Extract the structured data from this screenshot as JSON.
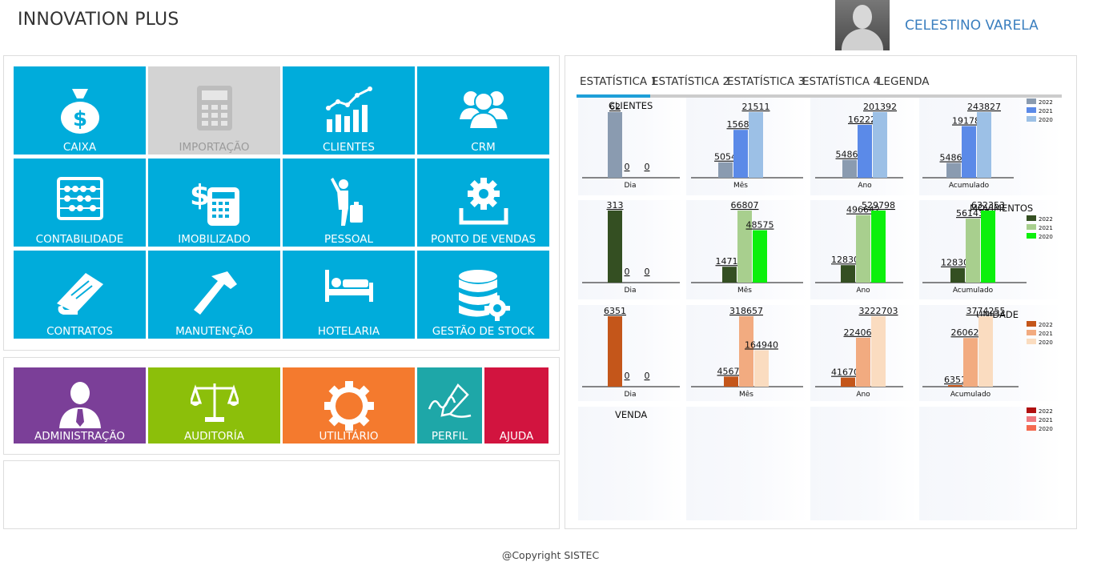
{
  "header": {
    "app_title": "INNOVATION PLUS",
    "user_name": "CELESTINO VARELA"
  },
  "modules": [
    {
      "label": "CAIXA",
      "icon": "money-bag-icon",
      "enabled": true
    },
    {
      "label": "IMPORTAÇÃO",
      "icon": "calculator-icon",
      "enabled": false
    },
    {
      "label": "CLIENTES",
      "icon": "chart-growth-icon",
      "enabled": true
    },
    {
      "label": "CRM",
      "icon": "users-icon",
      "enabled": true
    },
    {
      "label": "CONTABILIDADE",
      "icon": "abacus-icon",
      "enabled": true
    },
    {
      "label": "IMOBILIZADO",
      "icon": "dollar-calculator-icon",
      "enabled": true
    },
    {
      "label": "PESSOAL",
      "icon": "traveler-icon",
      "enabled": true
    },
    {
      "label": "PONTO DE VENDAS",
      "icon": "gear-tray-icon",
      "enabled": true
    },
    {
      "label": "CONTRATOS",
      "icon": "book-icon",
      "enabled": true
    },
    {
      "label": "MANUTENÇÃO",
      "icon": "hammer-icon",
      "enabled": true
    },
    {
      "label": "HOTELARIA",
      "icon": "bed-icon",
      "enabled": true
    },
    {
      "label": "GESTÃO DE STOCK",
      "icon": "database-gear-icon",
      "enabled": true
    }
  ],
  "admin_modules": [
    {
      "label": "ADMINISTRAÇÃO",
      "icon": "person-tie-icon",
      "color": "#7b3f98"
    },
    {
      "label": "AUDITORÍA",
      "icon": "scales-icon",
      "color": "#8cbf0a"
    },
    {
      "label": "UTILITÁRIO",
      "icon": "gear-icon",
      "color": "#f47a2e"
    },
    {
      "label": "PERFIL",
      "icon": "signature-icon",
      "color": "#1ea7a8"
    },
    {
      "label": "AJUDA",
      "icon": "",
      "color": "#d2143f"
    }
  ],
  "tabs": [
    "ESTATÍSTICA 1",
    "ESTATÍSTICA 2",
    "ESTATÍSTICA 3",
    "ESTATÍSTICA 4",
    "LEGENDA"
  ],
  "footer": {
    "copyright": "@Copyright  SISTEC"
  },
  "chart_data": [
    {
      "type": "bar",
      "title": "CLIENTES",
      "categories": [
        "Dia",
        "Mês",
        "Ano",
        "Acumulado"
      ],
      "colors": [
        "#8a9bb0",
        "#5b8ae8",
        "#9cc0e6"
      ],
      "series": [
        {
          "name": "2022",
          "values": [
            62,
            5054,
            54863,
            54863
          ]
        },
        {
          "name": "2021",
          "values": [
            0,
            15684,
            162221,
            191780
          ]
        },
        {
          "name": "2020",
          "values": [
            0,
            21511,
            201392,
            243827
          ]
        }
      ],
      "labels": [
        [
          "62",
          "0",
          "0"
        ],
        [
          "5054",
          "15684",
          "21511"
        ],
        [
          "54863",
          "162221",
          "201392"
        ],
        [
          "54863",
          "191780",
          "243827"
        ]
      ]
    },
    {
      "type": "bar",
      "title": "MOVIMENTOS",
      "categories": [
        "Dia",
        "Mês",
        "Ano",
        "Acumulado"
      ],
      "colors": [
        "#344f22",
        "#a8cf8e",
        "#0cf00c"
      ],
      "series": [
        {
          "name": "2022",
          "values": [
            313,
            14716,
            128300,
            128300
          ]
        },
        {
          "name": "2021",
          "values": [
            0,
            66807,
            496642,
            561435
          ]
        },
        {
          "name": "2020",
          "values": [
            0,
            48575,
            529798,
            632353
          ]
        }
      ],
      "labels": [
        [
          "313",
          "0",
          "0"
        ],
        [
          "14716",
          "66807",
          "48575"
        ],
        [
          "128300",
          "496642",
          "529798"
        ],
        [
          "128300",
          "561435",
          "632353"
        ]
      ]
    },
    {
      "type": "bar",
      "title": "UNIDADE",
      "categories": [
        "Dia",
        "Mês",
        "Ano",
        "Acumulado"
      ],
      "colors": [
        "#c4561a",
        "#f2ab80",
        "#fadcc0"
      ],
      "series": [
        {
          "name": "2022",
          "values": [
            6351,
            45675,
            416707,
            6351
          ]
        },
        {
          "name": "2021",
          "values": [
            0,
            318657,
            2240660,
            2606208
          ]
        },
        {
          "name": "2020",
          "values": [
            0,
            164940,
            3222703,
            3774255
          ]
        }
      ],
      "labels": [
        [
          "6351",
          "0",
          "0"
        ],
        [
          "45675",
          "318657",
          "164940"
        ],
        [
          "416707",
          "2240660",
          "3222703"
        ],
        [
          "6351",
          "2606208",
          "3774255"
        ]
      ]
    },
    {
      "type": "bar",
      "title": "VENDA",
      "categories": [],
      "colors": [
        "#b01010",
        "#f07a80",
        "#f46a50"
      ],
      "series": [
        {
          "name": "2022",
          "values": []
        },
        {
          "name": "2021",
          "values": []
        },
        {
          "name": "2020",
          "values": []
        }
      ],
      "labels": []
    }
  ]
}
